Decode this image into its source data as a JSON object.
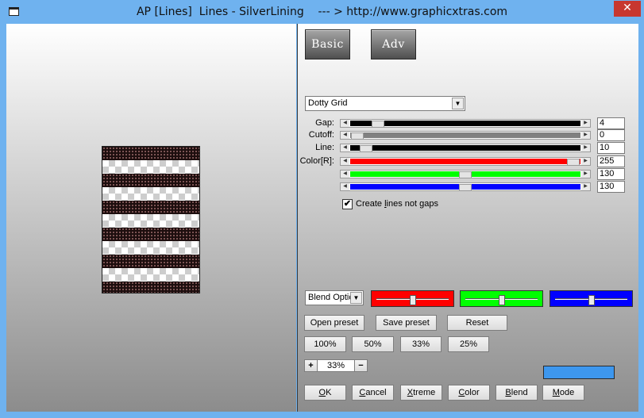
{
  "window": {
    "title": "AP [Lines]  Lines - SilverLining    --- > http://www.graphicxtras.com",
    "close_glyph": "✕"
  },
  "tabs": {
    "basic": "Basic",
    "adv": "Adv"
  },
  "pattern": {
    "selected": "Dotty Grid"
  },
  "sliders": [
    {
      "label": "Gap:",
      "value": "4",
      "track_color": "#000000",
      "thumb_pct": 12
    },
    {
      "label": "Cutoff:",
      "value": "0",
      "track_color": "#808080",
      "thumb_pct": 3
    },
    {
      "label": "Line:",
      "value": "10",
      "track_color": "#000000",
      "thumb_pct": 7
    },
    {
      "label": "Color[R]:",
      "value": "255",
      "track_color": "#ff0000",
      "thumb_pct": 97
    },
    {
      "label": "",
      "value": "130",
      "track_color": "#00ff00",
      "thumb_pct": 50
    },
    {
      "label": "",
      "value": "130",
      "track_color": "#0000ff",
      "thumb_pct": 50
    }
  ],
  "checkbox": {
    "label_pre": "Create ",
    "label_ul": "l",
    "label_post": "ines not gaps",
    "checked": "✔"
  },
  "blend": {
    "selected": "Blend Optic"
  },
  "color_sliders": [
    {
      "color": "#ff0000",
      "thumb_pct": 50
    },
    {
      "color": "#00ff00",
      "thumb_pct": 50
    },
    {
      "color": "#0000ff",
      "thumb_pct": 50
    }
  ],
  "preset_buttons": {
    "open": "Open preset",
    "save": "Save preset",
    "reset": "Reset"
  },
  "zoom_buttons": [
    "100%",
    "50%",
    "33%",
    "25%"
  ],
  "zoom": {
    "plus": "+",
    "value": "33%",
    "minus": "−"
  },
  "swatch_color": "#3d97ee",
  "action_buttons": [
    {
      "ul": "O",
      "rest": "K"
    },
    {
      "ul": "C",
      "rest": "ancel"
    },
    {
      "ul": "X",
      "rest": "treme"
    },
    {
      "ul": "C",
      "rest": "olor"
    },
    {
      "ul": "B",
      "rest": "lend"
    },
    {
      "ul": "M",
      "rest": "ode"
    }
  ]
}
